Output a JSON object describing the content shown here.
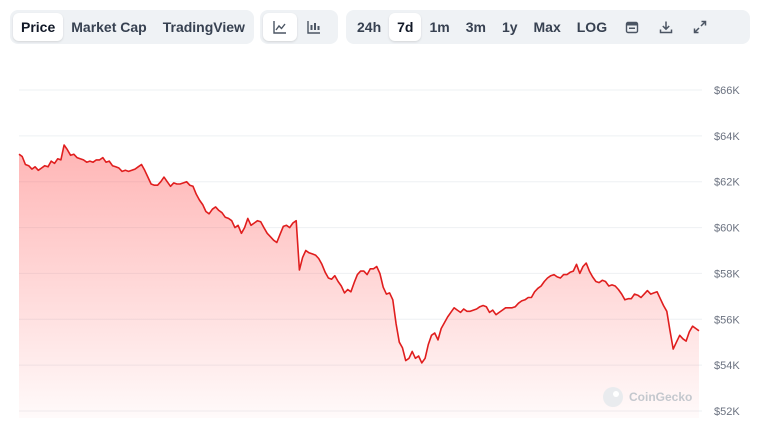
{
  "toolbar": {
    "type_tabs": [
      "Price",
      "Market Cap",
      "TradingView"
    ],
    "range_tabs": [
      "24h",
      "7d",
      "1m",
      "3m",
      "1y",
      "Max",
      "LOG"
    ],
    "active_type": "Price",
    "active_range": "7d"
  },
  "watermark": "CoinGecko",
  "colors": {
    "line": "#e01e1e",
    "fill": "#ff5a5a",
    "grid": "#eef0f3"
  },
  "chart_data": {
    "type": "area",
    "y_ticks": [
      "$52K",
      "$54K",
      "$56K",
      "$58K",
      "$60K",
      "$62K",
      "$64K",
      "$66K"
    ],
    "ylim": [
      52000,
      66000
    ],
    "grid": true,
    "series": [
      {
        "values": [
          63200,
          63100,
          62750,
          62700,
          62550,
          62650,
          62500,
          62600,
          62700,
          62650,
          62900,
          62800,
          63000,
          62950,
          63600,
          63400,
          63150,
          63200,
          63050,
          63000,
          62950,
          62850,
          62900,
          62850,
          62950,
          62950,
          63050,
          62850,
          62900,
          62700,
          62650,
          62600,
          62450,
          62500,
          62450,
          62500,
          62550,
          62650,
          62750,
          62500,
          62200,
          61900,
          61850,
          61850,
          62000,
          62200,
          62000,
          61800,
          61950,
          61900,
          61900,
          61950,
          62000,
          61850,
          61800,
          61450,
          61200,
          61000,
          60700,
          60600,
          60800,
          60900,
          60750,
          60650,
          60450,
          60400,
          60300,
          60000,
          60100,
          59750,
          60000,
          60400,
          60100,
          60200,
          60300,
          60250,
          60000,
          59750,
          59600,
          59450,
          59350,
          59700,
          60050,
          60100,
          60000,
          60200,
          60300,
          58150,
          58700,
          59000,
          58900,
          58850,
          58800,
          58650,
          58400,
          58050,
          57800,
          57750,
          57900,
          57650,
          57450,
          57150,
          57300,
          57200,
          57600,
          57950,
          58100,
          58100,
          57950,
          58200,
          58200,
          58300,
          58000,
          57400,
          57100,
          57150,
          56850,
          55800,
          55000,
          54750,
          54200,
          54300,
          54600,
          54300,
          54400,
          54100,
          54300,
          54900,
          55300,
          55400,
          55100,
          55600,
          55850,
          56100,
          56300,
          56500,
          56400,
          56300,
          56450,
          56350,
          56350,
          56400,
          56450,
          56550,
          56600,
          56550,
          56300,
          56400,
          56200,
          56300,
          56400,
          56500,
          56500,
          56500,
          56550,
          56700,
          56800,
          56850,
          56950,
          56950,
          57200,
          57350,
          57450,
          57650,
          57800,
          57900,
          57950,
          57850,
          57800,
          57950,
          57950,
          58050,
          58100,
          58400,
          58000,
          58300,
          58450,
          58100,
          57850,
          57650,
          57600,
          57700,
          57650,
          57450,
          57500,
          57450,
          57300,
          57100,
          56850,
          56900,
          56900,
          57100,
          57050,
          56950,
          57100,
          57250,
          57100,
          57150,
          57200,
          56900,
          56600,
          56350,
          55500,
          54700,
          55000,
          55300,
          55150,
          55050,
          55450,
          55700,
          55600,
          55500
        ]
      }
    ]
  }
}
